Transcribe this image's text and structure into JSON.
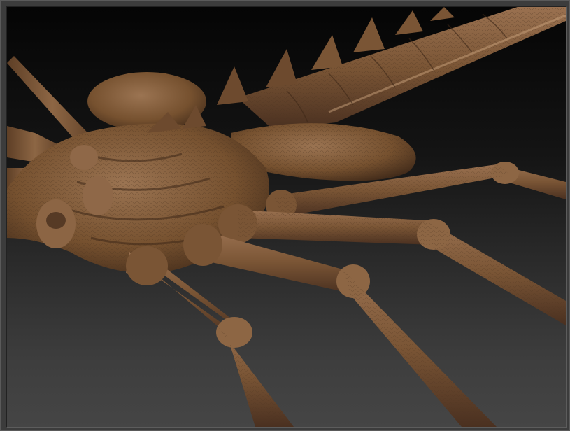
{
  "viewport": {
    "background_top": "#050505",
    "background_bottom": "#454545",
    "model_color": "#7a5535"
  }
}
